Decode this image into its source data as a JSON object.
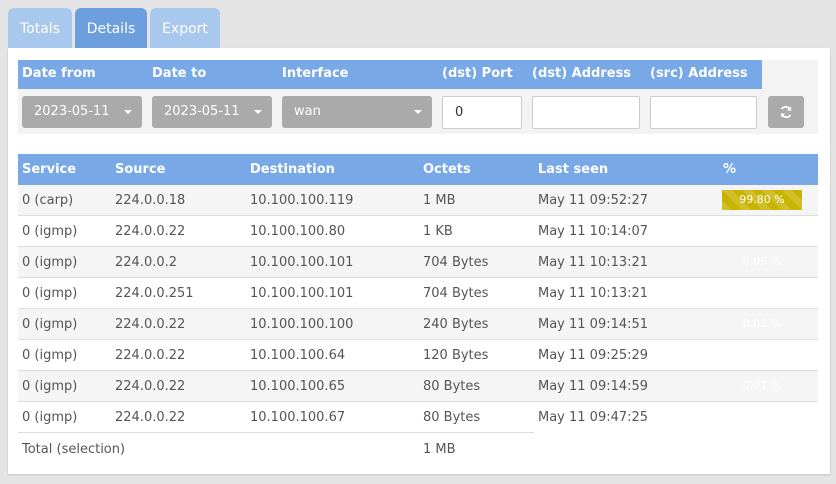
{
  "tabs": [
    {
      "label": "Totals"
    },
    {
      "label": "Details"
    },
    {
      "label": "Export"
    }
  ],
  "filters": {
    "headers": [
      "Date from",
      "Date to",
      "Interface",
      "(dst) Port",
      "(dst) Address",
      "(src) Address"
    ],
    "date_from": "2023-05-11",
    "date_to": "2023-05-11",
    "interface": "wan",
    "dst_port": "0",
    "dst_address": "",
    "src_address": ""
  },
  "table": {
    "columns": [
      "Service",
      "Source",
      "Destination",
      "Octets",
      "Last seen",
      "%"
    ],
    "rows": [
      {
        "service": "0 (carp)",
        "source": "224.0.0.18",
        "destination": "10.100.100.119",
        "octets": "1 MB",
        "last_seen": "May 11 09:52:27",
        "percent": "99.80 %"
      },
      {
        "service": "0 (igmp)",
        "source": "224.0.0.22",
        "destination": "10.100.100.80",
        "octets": "1 KB",
        "last_seen": "May 11 10:14:07",
        "percent": "0.08 %"
      },
      {
        "service": "0 (igmp)",
        "source": "224.0.0.2",
        "destination": "10.100.100.101",
        "octets": "704 Bytes",
        "last_seen": "May 11 10:13:21",
        "percent": "0.05 %"
      },
      {
        "service": "0 (igmp)",
        "source": "224.0.0.251",
        "destination": "10.100.100.101",
        "octets": "704 Bytes",
        "last_seen": "May 11 10:13:21",
        "percent": "0.05 %"
      },
      {
        "service": "0 (igmp)",
        "source": "224.0.0.22",
        "destination": "10.100.100.100",
        "octets": "240 Bytes",
        "last_seen": "May 11 09:14:51",
        "percent": "0.02 %"
      },
      {
        "service": "0 (igmp)",
        "source": "224.0.0.22",
        "destination": "10.100.100.64",
        "octets": "120 Bytes",
        "last_seen": "May 11 09:25:29",
        "percent": "0.01 %"
      },
      {
        "service": "0 (igmp)",
        "source": "224.0.0.22",
        "destination": "10.100.100.65",
        "octets": "80 Bytes",
        "last_seen": "May 11 09:14:59",
        "percent": "0.01 %"
      },
      {
        "service": "0 (igmp)",
        "source": "224.0.0.22",
        "destination": "10.100.100.67",
        "octets": "80 Bytes",
        "last_seen": "May 11 09:47:25",
        "percent": "0.01 %"
      }
    ],
    "total_label": "Total (selection)",
    "total_octets": "1 MB"
  },
  "colors": {
    "header_blue": "#79a8e6",
    "tab_active": "#6d9fdf",
    "tab_inactive": "#a9c8ee",
    "percent_bar": "#c8b400"
  },
  "icons": {
    "refresh": "refresh-icon",
    "caret": "caret-down-icon"
  }
}
